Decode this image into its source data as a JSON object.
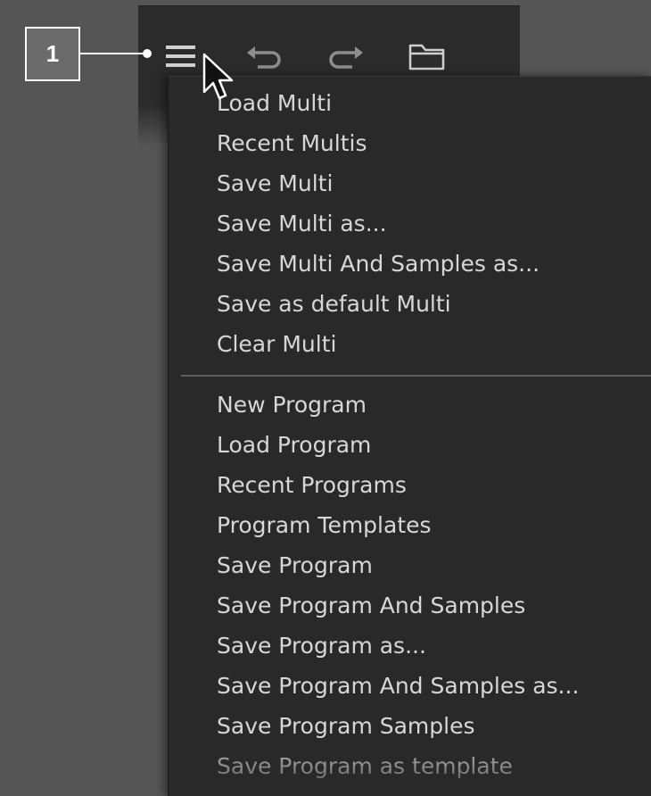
{
  "callout": {
    "number": "1"
  },
  "toolbar": {
    "icons": [
      "hamburger-menu-icon",
      "undo-icon",
      "redo-icon",
      "folder-icon"
    ]
  },
  "colors": {
    "background": "#555555",
    "toolbar": "#2b2b2b",
    "menu": "#292929",
    "menu_text": "#d7d7d7",
    "icon": "#cfcfcf",
    "callout_box": "#6b6b6b"
  },
  "menu": {
    "multi_items": [
      "Load Multi",
      "Recent Multis",
      "Save Multi",
      "Save Multi as...",
      "Save Multi And Samples as...",
      "Save as default Multi",
      "Clear Multi"
    ],
    "program_items": [
      "New Program",
      "Load Program",
      "Recent Programs",
      "Program Templates",
      "Save Program",
      "Save Program And Samples",
      "Save Program as...",
      "Save Program And Samples as...",
      "Save Program Samples",
      "Save Program as template"
    ]
  }
}
